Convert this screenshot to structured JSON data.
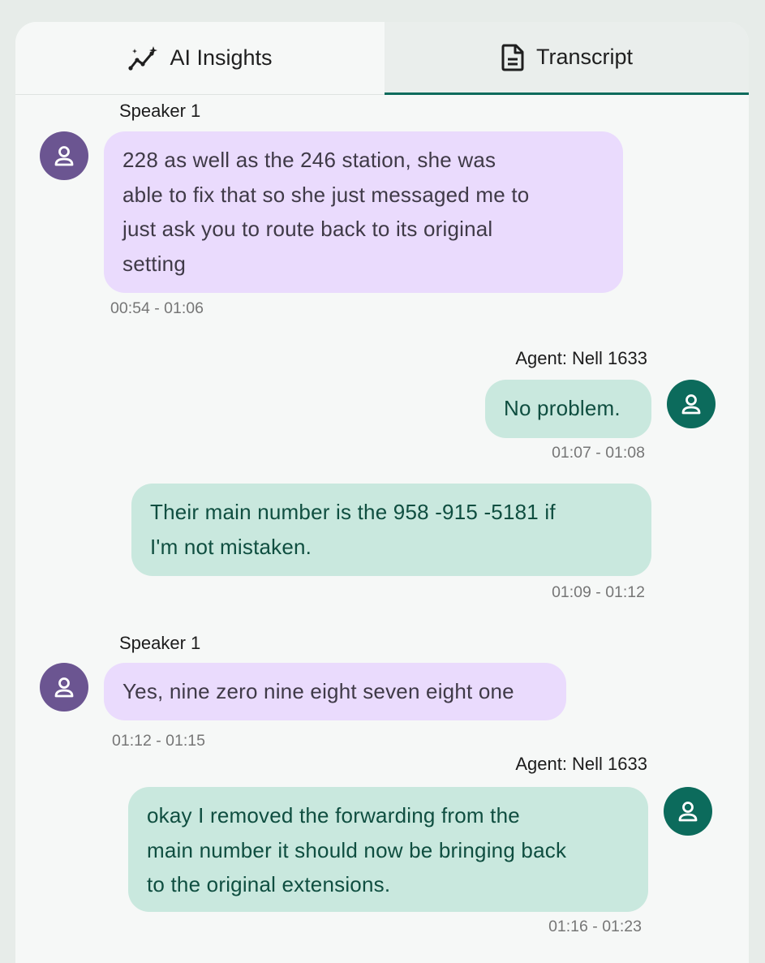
{
  "tabs": {
    "ai_insights": "AI Insights",
    "transcript": "Transcript",
    "active": "Transcript"
  },
  "colors": {
    "customer_avatar": "#6b5591",
    "agent_avatar": "#0c6b5c",
    "customer_bubble": "#eadbfd",
    "agent_bubble": "#c9e8de",
    "active_tab_underline": "#0c6b5c"
  },
  "messages": [
    {
      "role": "customer",
      "speaker": "Speaker 1",
      "lines": [
        "228 as well as the 246 station, she was",
        "able to fix that so she just messaged me to",
        "just ask you to  route  back to its original",
        "setting"
      ],
      "time": "00:54 - 01:06",
      "avatar_icon": "person-icon"
    },
    {
      "role": "agent",
      "speaker": "Agent: Nell 1633",
      "lines": [
        "No problem."
      ],
      "time": "01:07 - 01:08",
      "avatar_icon": "person-icon"
    },
    {
      "role": "agent",
      "speaker": "",
      "lines": [
        "Their main number is the 958 -915 -5181 if",
        "I'm not mistaken."
      ],
      "time": "01:09 - 01:12"
    },
    {
      "role": "customer",
      "speaker": "Speaker 1",
      "lines": [
        "Yes, nine zero nine eight seven eight one"
      ],
      "time": "01:12 - 01:15",
      "avatar_icon": "person-icon"
    },
    {
      "role": "agent",
      "speaker": "Agent: Nell 1633",
      "lines": [
        "okay I removed the forwarding from the",
        "main number it should now be bringing back",
        "to the original extensions."
      ],
      "time": "01:16 - 01:23",
      "avatar_icon": "person-icon"
    }
  ]
}
